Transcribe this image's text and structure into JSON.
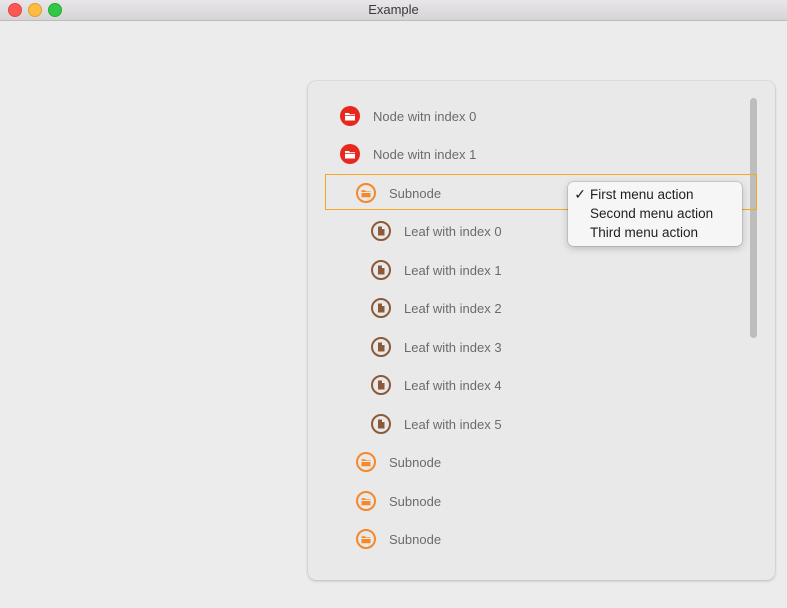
{
  "window": {
    "title": "Example"
  },
  "tree": {
    "rows": [
      {
        "label": "Node witn index 0",
        "icon": "folder-icon",
        "color": "#e8271f"
      },
      {
        "label": "Node witn index 1",
        "icon": "folder-icon",
        "color": "#e8271f"
      },
      {
        "label": "Subnode",
        "icon": "folder-icon",
        "color": "#f5882a",
        "selected": true
      },
      {
        "label": "Leaf with index 0",
        "icon": "document-icon",
        "color": "#8a5a3a"
      },
      {
        "label": "Leaf with index 1",
        "icon": "document-icon",
        "color": "#8a5a3a"
      },
      {
        "label": "Leaf with index 2",
        "icon": "document-icon",
        "color": "#8a5a3a"
      },
      {
        "label": "Leaf with index 3",
        "icon": "document-icon",
        "color": "#8a5a3a"
      },
      {
        "label": "Leaf with index 4",
        "icon": "document-icon",
        "color": "#8a5a3a"
      },
      {
        "label": "Leaf with index 5",
        "icon": "document-icon",
        "color": "#8a5a3a"
      },
      {
        "label": "Subnode",
        "icon": "folder-icon",
        "color": "#f5882a"
      },
      {
        "label": "Subnode",
        "icon": "folder-icon",
        "color": "#f5882a"
      },
      {
        "label": "Subnode",
        "icon": "folder-icon",
        "color": "#f5882a"
      }
    ]
  },
  "context_menu": {
    "items": [
      {
        "label": "First menu action",
        "checked": true,
        "check_mark": "✓"
      },
      {
        "label": "Second menu action",
        "checked": false
      },
      {
        "label": "Third menu action",
        "checked": false
      }
    ]
  },
  "colors": {
    "selection_border": "#f5a623"
  }
}
